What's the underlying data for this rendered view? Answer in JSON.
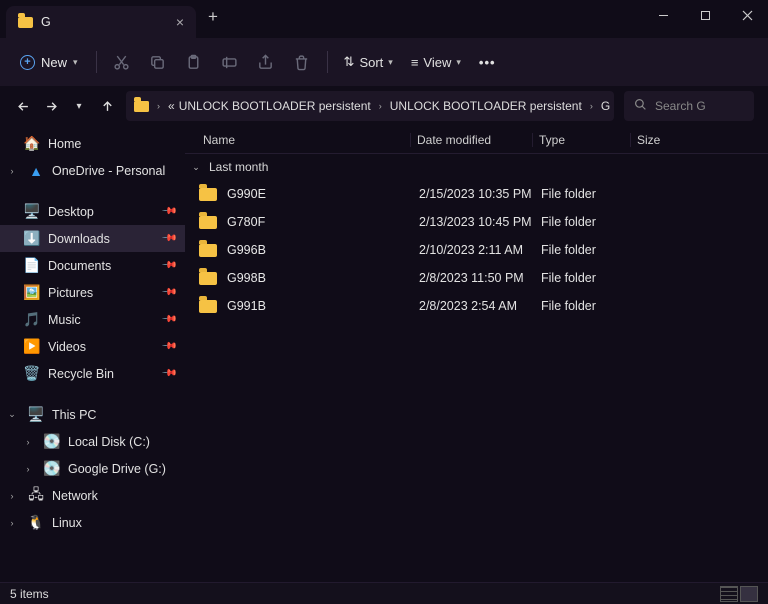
{
  "tab": {
    "title": "G"
  },
  "toolbar": {
    "new_label": "New",
    "sort_label": "Sort",
    "view_label": "View"
  },
  "breadcrumbs": {
    "prefix": "«",
    "items": [
      "UNLOCK BOOTLOADER persistent",
      "UNLOCK BOOTLOADER persistent",
      "G"
    ]
  },
  "search": {
    "placeholder": "Search G"
  },
  "sidebar": {
    "home": "Home",
    "onedrive": "OneDrive - Personal",
    "quick": [
      {
        "label": "Desktop",
        "icon": "🖥️"
      },
      {
        "label": "Downloads",
        "icon": "⬇️",
        "selected": true
      },
      {
        "label": "Documents",
        "icon": "📄"
      },
      {
        "label": "Pictures",
        "icon": "🖼️"
      },
      {
        "label": "Music",
        "icon": "🎵"
      },
      {
        "label": "Videos",
        "icon": "▶️"
      },
      {
        "label": "Recycle Bin",
        "icon": "🗑️"
      }
    ],
    "thispc": "This PC",
    "drives": [
      {
        "label": "Local Disk (C:)",
        "icon": "💽"
      },
      {
        "label": "Google Drive (G:)",
        "icon": "💽"
      }
    ],
    "network": "Network",
    "linux": "Linux"
  },
  "columns": {
    "name": "Name",
    "date": "Date modified",
    "type": "Type",
    "size": "Size"
  },
  "group_label": "Last month",
  "rows": [
    {
      "name": "G990E",
      "date": "2/15/2023 10:35 PM",
      "type": "File folder"
    },
    {
      "name": "G780F",
      "date": "2/13/2023 10:45 PM",
      "type": "File folder"
    },
    {
      "name": "G996B",
      "date": "2/10/2023 2:11 AM",
      "type": "File folder"
    },
    {
      "name": "G998B",
      "date": "2/8/2023 11:50 PM",
      "type": "File folder"
    },
    {
      "name": "G991B",
      "date": "2/8/2023 2:54 AM",
      "type": "File folder"
    }
  ],
  "status": {
    "count": "5 items"
  }
}
